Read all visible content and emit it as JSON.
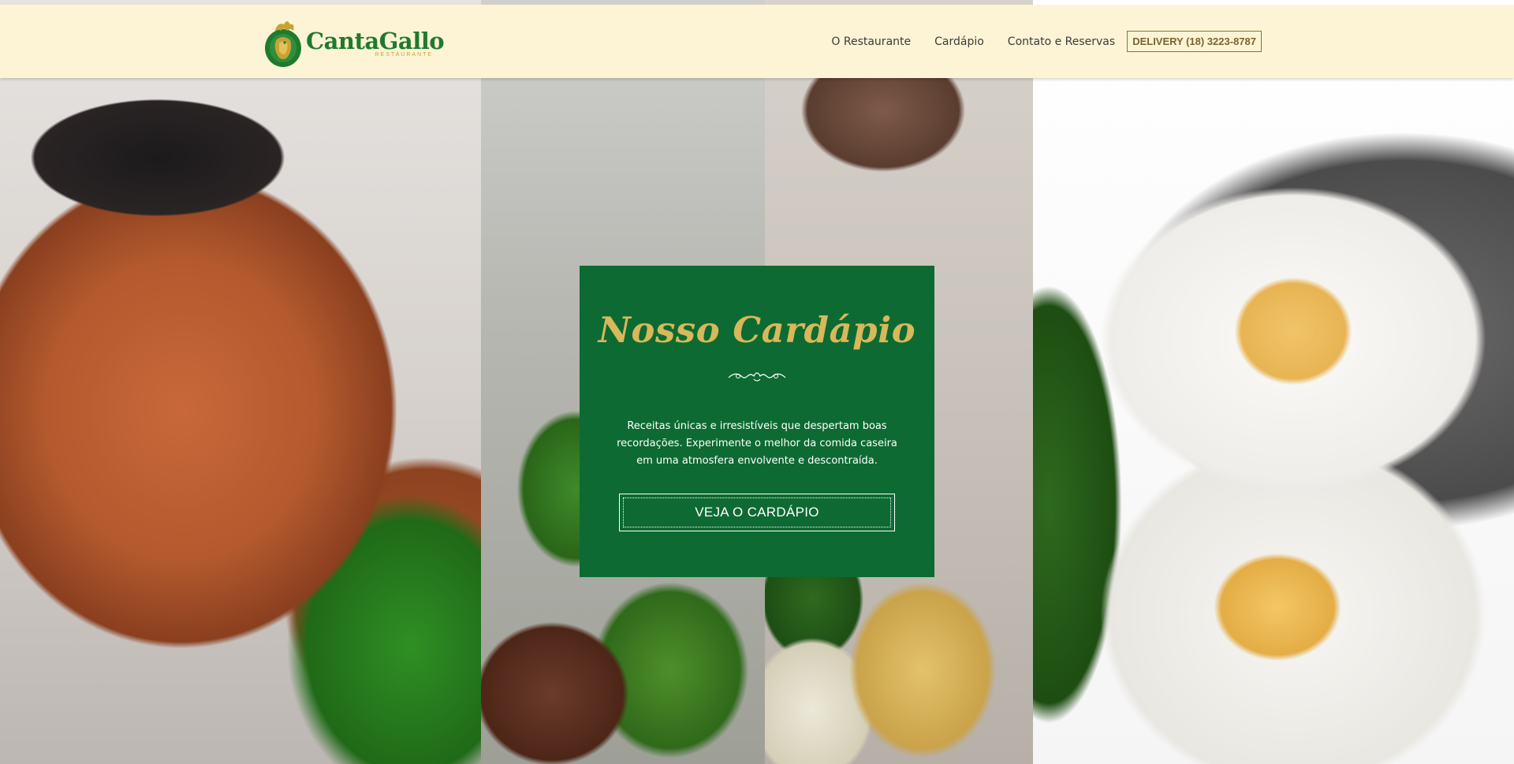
{
  "header": {
    "logo": {
      "name": "CantaGallo",
      "subtitle": "RESTAURANTE"
    },
    "nav": [
      {
        "label": "O Restaurante"
      },
      {
        "label": "Cardápio"
      },
      {
        "label": "Contato e Reservas"
      }
    ],
    "delivery": "DELIVERY (18) 3223-8787"
  },
  "hero": {
    "title": "Nosso Cardápio",
    "description": "Receitas únicas e irresistíveis que despertam boas recordações. Experimente o melhor da comida caseira em uma atmosfera envolvente e descontraída.",
    "button_label": "VEJA O CARDÁPIO"
  },
  "colors": {
    "brand_green": "#0d6a32",
    "brand_gold": "#d7b85a",
    "header_bg": "#fcf4d4"
  },
  "icons": {
    "logo": "rooster-icon",
    "divider": "ornament-divider-icon"
  }
}
